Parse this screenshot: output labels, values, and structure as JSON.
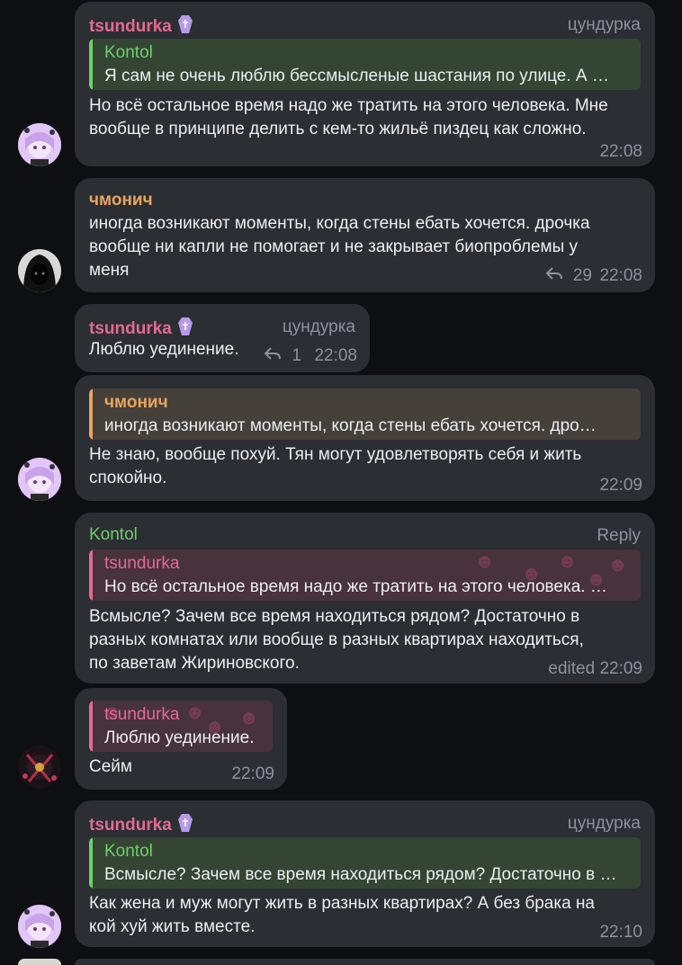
{
  "colors": {
    "background": "#0e0f12",
    "bubble": "#2b2e33",
    "name_pink": "#e36a92",
    "name_orange": "#e9a45e",
    "name_green": "#6fcf6b",
    "meta": "#8d939a"
  },
  "messages": [
    {
      "author": "tsundurka",
      "emoji": "coffin-icon",
      "badge": "цундурка",
      "reply_author": "Kontol",
      "reply_text": "Я сам не очень люблю бессмысленые шастания по улице. А …",
      "lines": [
        "Но всё остальное время надо же тратить на этого человека. Мне",
        "вообще в принципе делить с кем-то жильё пиздец как сложно."
      ],
      "time": "22:08"
    },
    {
      "author": "чмонич",
      "lines": [
        "иногда возникают моменты, когда стены ебать хочется. дрочка",
        "вообще ни капли не помогает и не закрывает биопроблемы у",
        "меня"
      ],
      "replies_count": "29",
      "time": "22:08"
    },
    {
      "author": "tsundurka",
      "emoji": "coffin-icon",
      "badge": "цундурка",
      "lines": [
        "Люблю уединение."
      ],
      "replies_count": "1",
      "time": "22:08"
    },
    {
      "reply_author": "чмонич",
      "reply_text": "иногда возникают моменты, когда стены ебать хочется. дро…",
      "lines": [
        "Не знаю, вообще похуй. Тян могут удовлетворять себя и жить",
        "спокойно."
      ],
      "time": "22:09"
    },
    {
      "author": "Kontol",
      "badge": "Reply",
      "reply_author": "tsundurka",
      "reply_text": "Но всё остальное время надо же тратить на этого человека. …",
      "lines": [
        "Всмысле? Зачем все время находиться рядом? Достаточно в",
        "разных комнатах или вообще в разных квартирах находиться,",
        "по заветам Жириновского."
      ],
      "time": "edited 22:09"
    },
    {
      "reply_author": "tsundurka",
      "reply_text": "Люблю уединение.",
      "lines": [
        "Сейм"
      ],
      "time": "22:09"
    },
    {
      "author": "tsundurka",
      "emoji": "coffin-icon",
      "badge": "цундурка",
      "reply_author": "Kontol",
      "reply_text": "Всмысле? Зачем все время находиться рядом? Достаточно в …",
      "lines": [
        "Как жена и муж могут жить в разных квартирах? А без брака на",
        "кой хуй жить вместе."
      ],
      "time": "22:10"
    }
  ]
}
